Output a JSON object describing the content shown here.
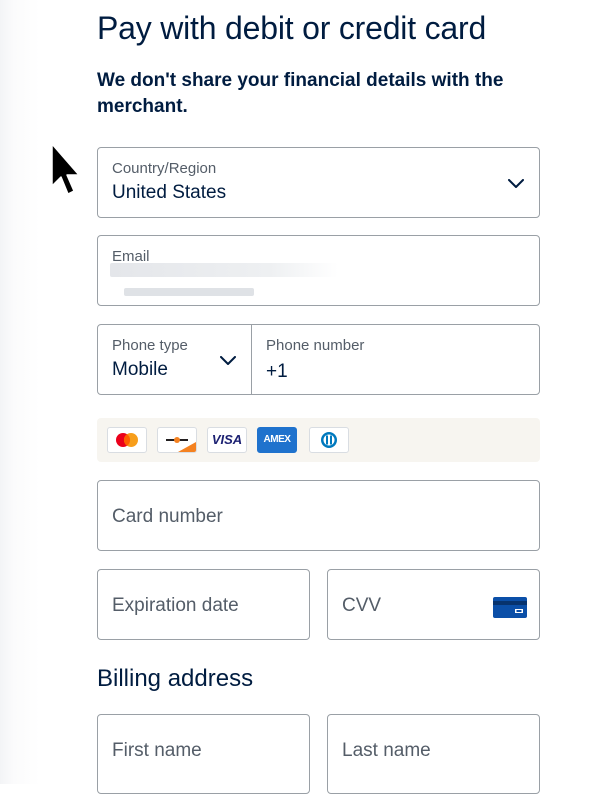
{
  "header": {
    "title": "Pay with debit or credit card",
    "subtitle": "We don't share your financial details with the merchant."
  },
  "country": {
    "label": "Country/Region",
    "value": "United States",
    "icon": "chevron-down-icon"
  },
  "email": {
    "label": "Email",
    "value_redacted": true
  },
  "phone": {
    "type_label": "Phone type",
    "type_value": "Mobile",
    "number_label": "Phone number",
    "number_value": "+1"
  },
  "accepted_cards": [
    {
      "name": "mastercard-icon"
    },
    {
      "name": "discover-icon"
    },
    {
      "name": "visa-icon",
      "text": "VISA"
    },
    {
      "name": "amex-icon",
      "text": "AMEX"
    },
    {
      "name": "diners-club-icon"
    }
  ],
  "card_number": {
    "placeholder": "Card number"
  },
  "expiration": {
    "placeholder": "Expiration date"
  },
  "cvv": {
    "placeholder": "CVV",
    "icon": "card-back-icon"
  },
  "billing": {
    "title": "Billing address",
    "first_name_placeholder": "First name",
    "last_name_placeholder": "Last name"
  },
  "colors": {
    "text_primary": "#001c40",
    "text_secondary": "#545d68",
    "border": "#9aa0a6",
    "amex_blue": "#1f72cd",
    "card_strip_bg": "#f7f5f0"
  }
}
